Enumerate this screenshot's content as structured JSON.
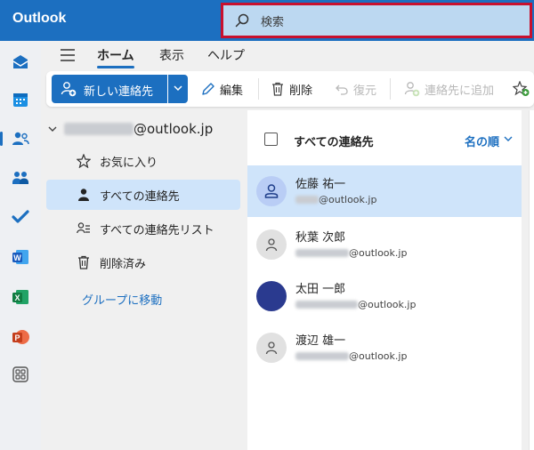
{
  "app": {
    "title": "Outlook"
  },
  "search": {
    "placeholder": "検索",
    "highlight_color": "#c8102e"
  },
  "rail": {
    "items": [
      {
        "name": "mail",
        "icon": "mail-icon"
      },
      {
        "name": "calendar",
        "icon": "calendar-icon"
      },
      {
        "name": "people",
        "icon": "people-icon",
        "active": true
      },
      {
        "name": "teams",
        "icon": "teams-icon"
      },
      {
        "name": "todo",
        "icon": "todo-icon"
      },
      {
        "name": "word",
        "icon": "word-icon",
        "letter": "W"
      },
      {
        "name": "excel",
        "icon": "excel-icon",
        "letter": "X"
      },
      {
        "name": "powerpoint",
        "icon": "powerpoint-icon",
        "letter": "P"
      },
      {
        "name": "apps",
        "icon": "apps-icon"
      }
    ]
  },
  "ribbon": {
    "tabs": [
      {
        "label": "ホーム",
        "active": true
      },
      {
        "label": "表示"
      },
      {
        "label": "ヘルプ"
      }
    ]
  },
  "toolbar": {
    "new_contact": "新しい連絡先",
    "edit": "編集",
    "delete": "削除",
    "restore": "復元",
    "add_to_contacts": "連絡先に追加"
  },
  "folders": {
    "account_suffix": "@outlook.jp",
    "items": [
      {
        "label": "お気に入り",
        "icon": "star-icon"
      },
      {
        "label": "すべての連絡先",
        "icon": "person-icon",
        "selected": true
      },
      {
        "label": "すべての連絡先リスト",
        "icon": "contact-list-icon"
      },
      {
        "label": "削除済み",
        "icon": "trash-icon"
      }
    ],
    "group_link": "グループに移動"
  },
  "list": {
    "title": "すべての連絡先",
    "sort_label": "名の順",
    "contacts": [
      {
        "name": "佐藤 祐一",
        "email_domain": "@outlook.jp",
        "selected": true,
        "avatar": "outline"
      },
      {
        "name": "秋葉 次郎",
        "email_domain": "@outlook.jp",
        "avatar": "grey"
      },
      {
        "name": "太田 一郎",
        "email_domain": "@outlook.jp",
        "avatar": "navy"
      },
      {
        "name": "渡辺 雄一",
        "email_domain": "@outlook.jp",
        "avatar": "grey"
      }
    ]
  },
  "colors": {
    "accent": "#1c6fc0",
    "selected_bg": "#cfe4fa"
  }
}
